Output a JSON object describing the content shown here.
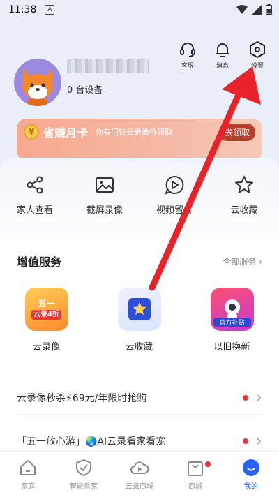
{
  "status_bar": {
    "time": "11:38",
    "notification_icon": "A"
  },
  "top_actions": [
    {
      "label": "客服",
      "icon": "headset-icon"
    },
    {
      "label": "消息",
      "icon": "bell-icon"
    },
    {
      "label": "设置",
      "icon": "settings-hex-icon"
    }
  ],
  "profile": {
    "device_count": "0 台设备"
  },
  "promo": {
    "title": "省赚月卡",
    "subtitle": "· 你有门铃云录像待领取",
    "button": "去领取"
  },
  "quick_actions": [
    {
      "label": "家人查看",
      "icon": "share-icon"
    },
    {
      "label": "截屏录像",
      "icon": "image-icon"
    },
    {
      "label": "视频留言",
      "icon": "video-message-icon"
    },
    {
      "label": "云收藏",
      "icon": "star-icon"
    }
  ],
  "services": {
    "title": "增值服务",
    "more": "全部服务",
    "items": [
      {
        "label": "云录像",
        "badge_top": "五一",
        "badge_bottom": "云录4折"
      },
      {
        "label": "云收藏"
      },
      {
        "label": "以旧换新",
        "badge": "官方补贴"
      }
    ]
  },
  "promos_list": [
    {
      "text": "云录像秒杀⚡69元/年限时抢购"
    },
    {
      "text": "「五一放心游」🌏AI云录看家看宠"
    }
  ],
  "tabs": [
    {
      "label": "家庭",
      "icon": "home-icon"
    },
    {
      "label": "智能看家",
      "icon": "shield-check-icon"
    },
    {
      "label": "云录商城",
      "icon": "cloud-play-icon"
    },
    {
      "label": "商城",
      "icon": "shopping-bag-icon"
    },
    {
      "label": "我的",
      "icon": "me-smile-icon"
    }
  ],
  "colors": {
    "accent": "#2b62ff",
    "alert": "#e8333a",
    "arrow": "#e8232a"
  }
}
